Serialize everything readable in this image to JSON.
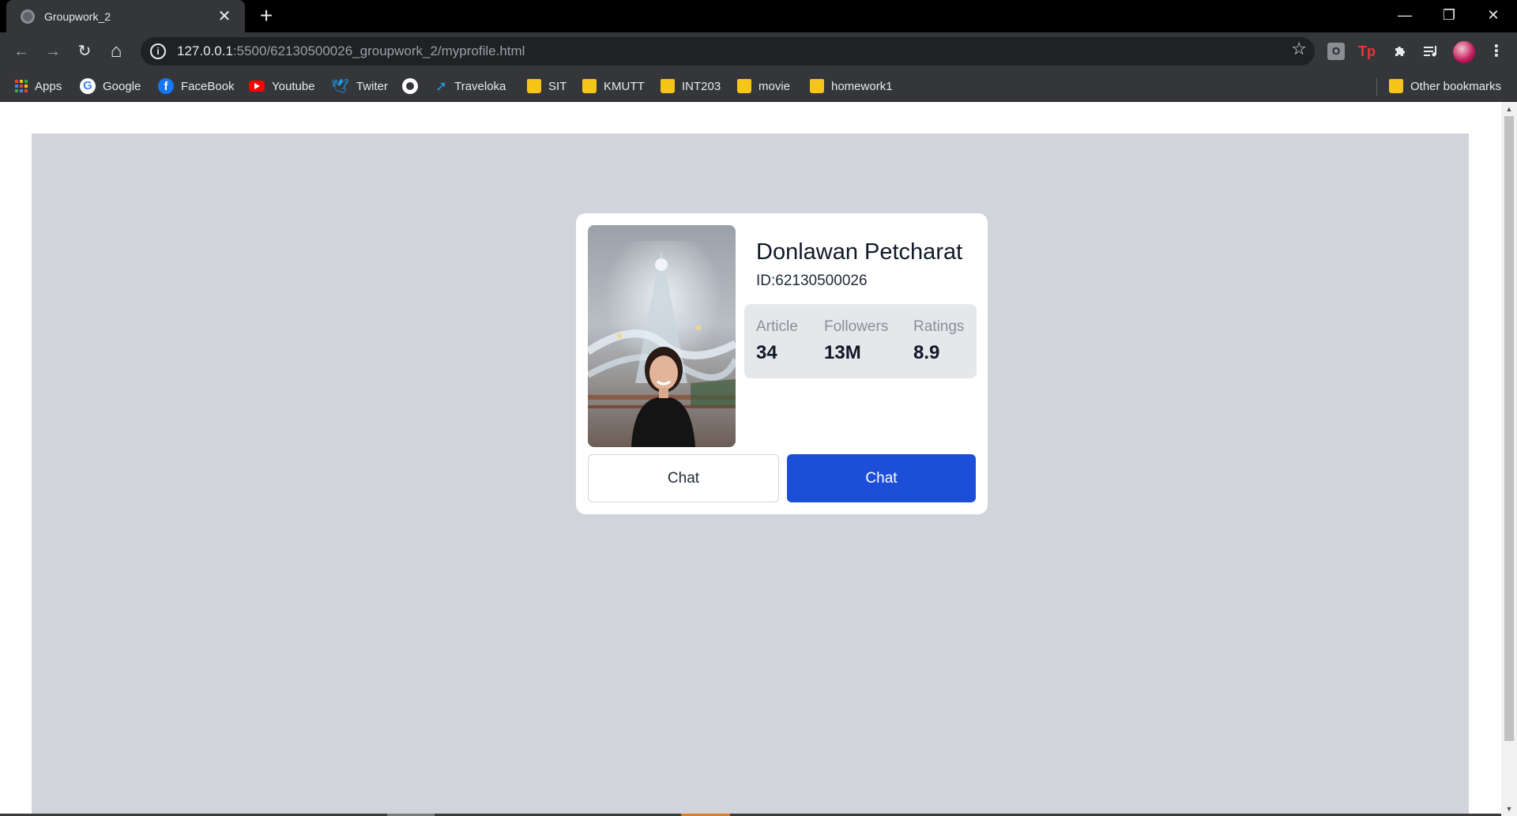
{
  "browser": {
    "tab": {
      "title": "Groupwork_2",
      "close_glyph": "✕"
    },
    "new_tab_glyph": "+",
    "window_controls": {
      "minimize": "—",
      "restore": "❐",
      "close": "✕"
    },
    "nav": {
      "back": "←",
      "forward": "→",
      "reload": "↻",
      "home": "⌂"
    },
    "address": {
      "host": "127.0.0.1",
      "rest": ":5500/62130500026_groupwork_2/myprofile.html"
    },
    "bookmarks": [
      {
        "label": "Apps",
        "icon": "apps-grid-icon"
      },
      {
        "label": "Google",
        "icon": "google-icon"
      },
      {
        "label": "FaceBook",
        "icon": "facebook-icon"
      },
      {
        "label": "Youtube",
        "icon": "youtube-icon"
      },
      {
        "label": "Twiter",
        "icon": "twitter-icon"
      },
      {
        "label": "",
        "icon": "github-icon"
      },
      {
        "label": "Traveloka",
        "icon": "traveloka-icon"
      },
      {
        "label": "SIT",
        "icon": "folder-icon"
      },
      {
        "label": "KMUTT",
        "icon": "folder-icon"
      },
      {
        "label": "INT203",
        "icon": "folder-icon"
      },
      {
        "label": "movie",
        "icon": "folder-icon"
      },
      {
        "label": "homework1",
        "icon": "folder-icon"
      }
    ],
    "other_bookmarks": "Other bookmarks",
    "extensions": {
      "o": "O",
      "tp": "Tp"
    }
  },
  "profile": {
    "name": "Donlawan Petcharat",
    "id_text": "ID:62130500026",
    "stats": [
      {
        "label": "Article",
        "value": "34"
      },
      {
        "label": "Followers",
        "value": "13M"
      },
      {
        "label": "Ratings",
        "value": "8.9"
      }
    ],
    "buttons": {
      "secondary": "Chat",
      "primary": "Chat"
    }
  },
  "colors": {
    "page_bg": "#d1d5db",
    "card_bg": "#ffffff",
    "stats_bg": "#e5e7eb",
    "primary_button": "#1d4ed8",
    "browser_chrome": "#35363a"
  }
}
